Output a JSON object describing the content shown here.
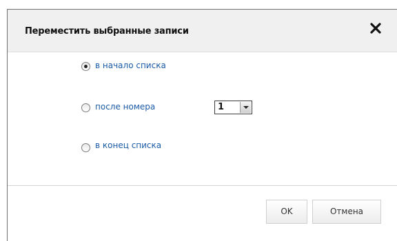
{
  "dialog": {
    "title": "Переместить выбранные записи",
    "close_icon": "close-icon",
    "options": [
      {
        "label": "в начало списка",
        "checked": true
      },
      {
        "label": "после номера",
        "checked": false
      },
      {
        "label": "в конец списка",
        "checked": false
      }
    ],
    "position_select": {
      "value": "1"
    },
    "ok_label": "OK",
    "cancel_label": "Отмена"
  }
}
